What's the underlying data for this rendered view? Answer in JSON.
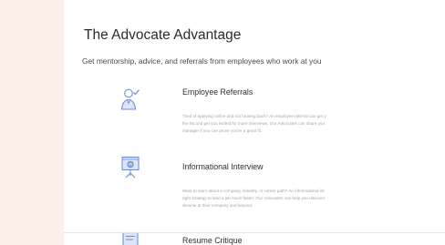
{
  "section": {
    "title": "The Advocate Advantage",
    "subtitle": "Get mentorship, advice, and referrals from employees who work at you"
  },
  "features": [
    {
      "title": "Employee Referrals",
      "icon": "person-check-icon",
      "lines": [
        "Tired of applying online and not hearing back? An employee referral can get y",
        "the list and get you invited for more interviews. Our Advocates can share you",
        "manager if you can prove you're a great fit."
      ]
    },
    {
      "title": "Informational Interview",
      "icon": "presentation-board-icon",
      "lines": [
        "Want to learn about a company, industry, or career path? An informational int",
        "right strategy to land a job much faster. Our Advocates can help you discover",
        "dreams at their company and beyond."
      ]
    },
    {
      "title": "Resume Critique",
      "icon": "document-icon",
      "lines": []
    }
  ],
  "colors": {
    "page_background": "#fbefe8",
    "card_background": "#ffffff",
    "icon_blue": "#6f8fd4",
    "icon_fill": "#dbe5f7"
  }
}
